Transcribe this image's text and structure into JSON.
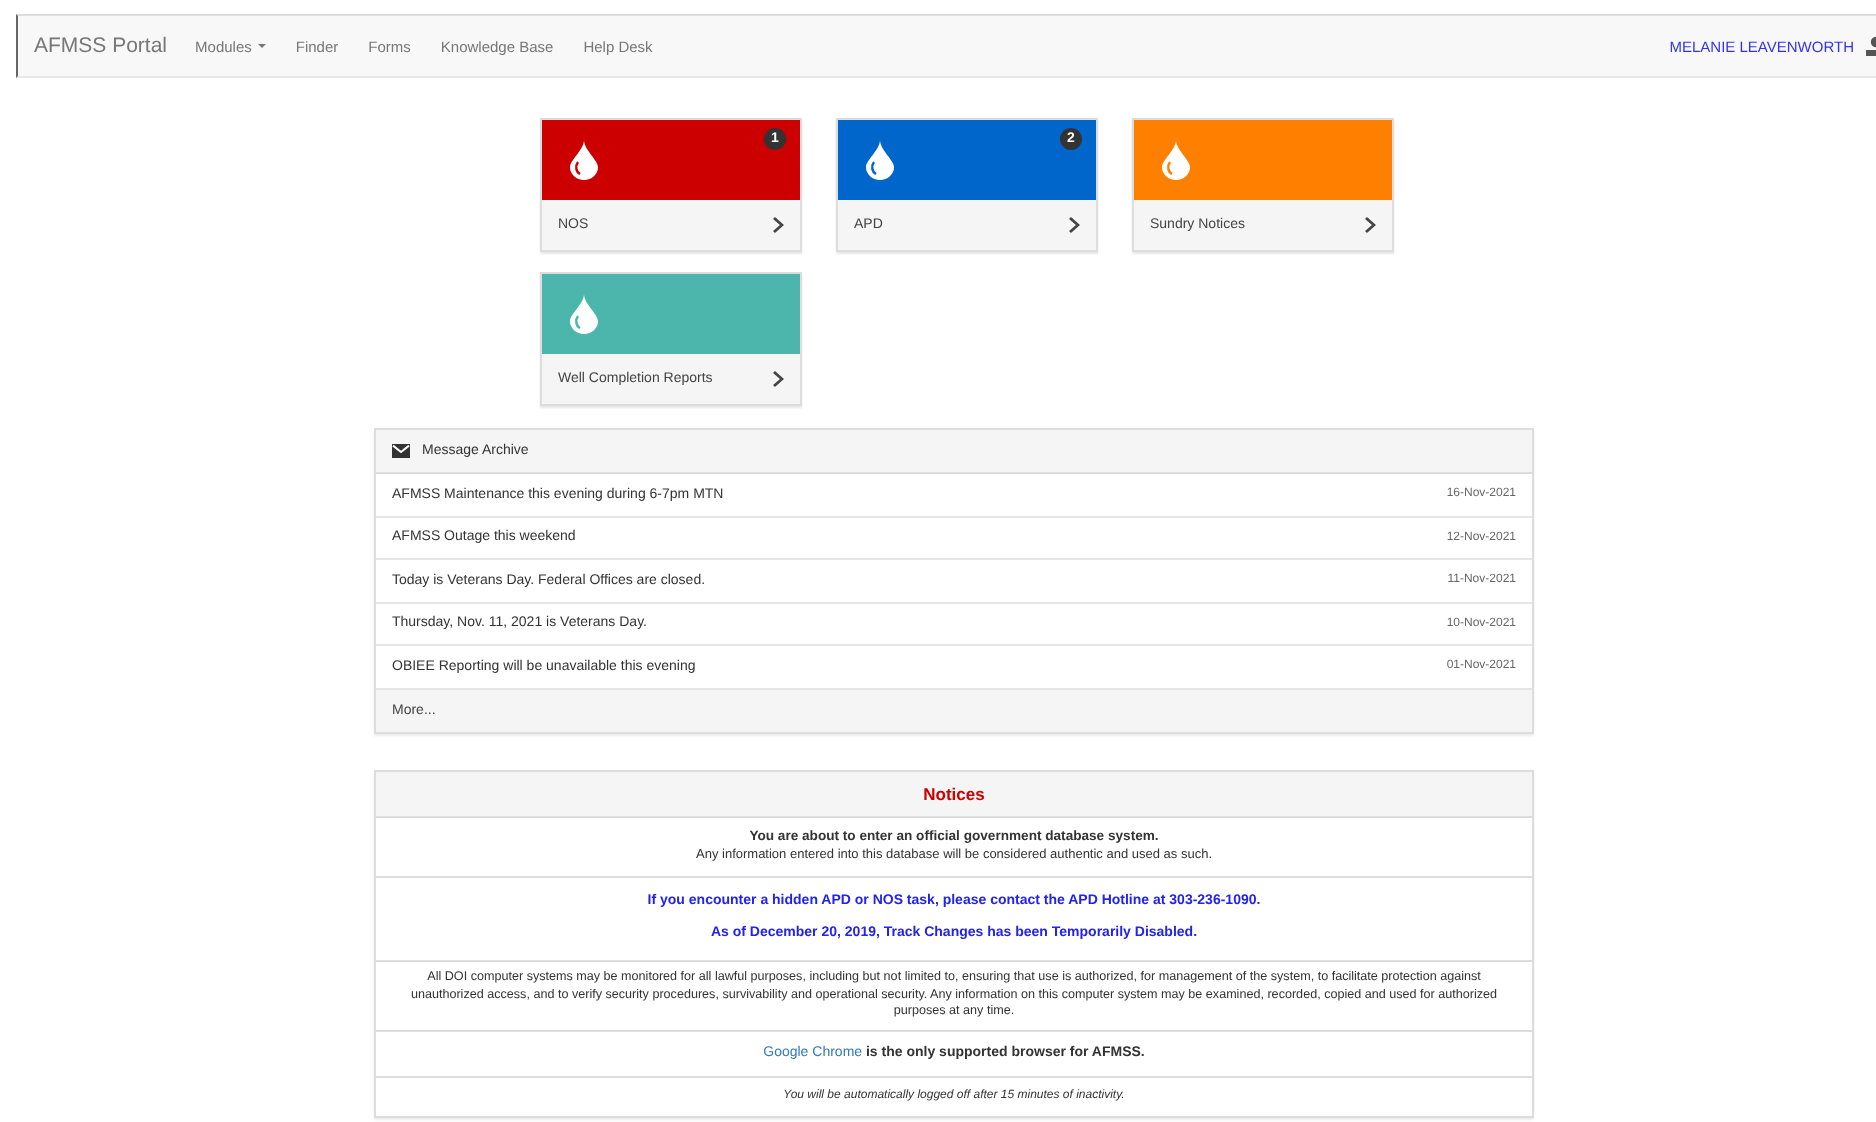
{
  "navbar": {
    "brand": "AFMSS Portal",
    "items": [
      {
        "label": "Modules",
        "dropdown": true
      },
      {
        "label": "Finder",
        "dropdown": false
      },
      {
        "label": "Forms",
        "dropdown": false
      },
      {
        "label": "Knowledge Base",
        "dropdown": false
      },
      {
        "label": "Help Desk",
        "dropdown": false
      }
    ],
    "user": "MELANIE LEAVENWORTH"
  },
  "tiles": [
    {
      "label": "NOS",
      "color": "#cc0000",
      "badge": "1"
    },
    {
      "label": "APD",
      "color": "#0066cc",
      "badge": "2"
    },
    {
      "label": "Sundry Notices",
      "color": "#ff8000"
    },
    {
      "label": "Well Completion Reports",
      "color": "#4db6ac"
    }
  ],
  "message_archive": {
    "title": "Message Archive",
    "messages": [
      {
        "text": "AFMSS Maintenance this evening during 6-7pm MTN",
        "date": "16-Nov-2021"
      },
      {
        "text": "AFMSS Outage this weekend",
        "date": "12-Nov-2021"
      },
      {
        "text": "Today is Veterans Day. Federal Offices are closed.",
        "date": "11-Nov-2021"
      },
      {
        "text": "Thursday, Nov. 11, 2021 is Veterans Day.",
        "date": "10-Nov-2021"
      },
      {
        "text": "OBIEE Reporting will be unavailable this evening",
        "date": "01-Nov-2021"
      }
    ],
    "more": "More..."
  },
  "notices": {
    "title": "Notices",
    "sections": [
      {
        "kind": "intro",
        "heading": "You are about to enter an official government database system.",
        "text": "Any information entered into this database will be considered authentic and used as such."
      },
      {
        "kind": "alert",
        "lines": [
          "If you encounter a hidden APD or NOS task, please contact the APD Hotline at 303-236-1090.",
          "As of December 20, 2019, Track Changes has been Temporarily Disabled."
        ]
      },
      {
        "kind": "plain",
        "text": "All DOI computer systems may be monitored for all lawful purposes, including but not limited to, ensuring that use is authorized, for management of the system, to facilitate protection against unauthorized access, and to verify security procedures, survivability and operational security. Any information on this computer system may be examined, recorded, copied and used for authorized purposes at any time."
      },
      {
        "kind": "browser",
        "link": "Google Chrome",
        "text": "is the only supported browser for AFMSS."
      },
      {
        "kind": "footnote",
        "text": "You will be automatically logged off after 15 minutes of inactivity."
      }
    ]
  }
}
